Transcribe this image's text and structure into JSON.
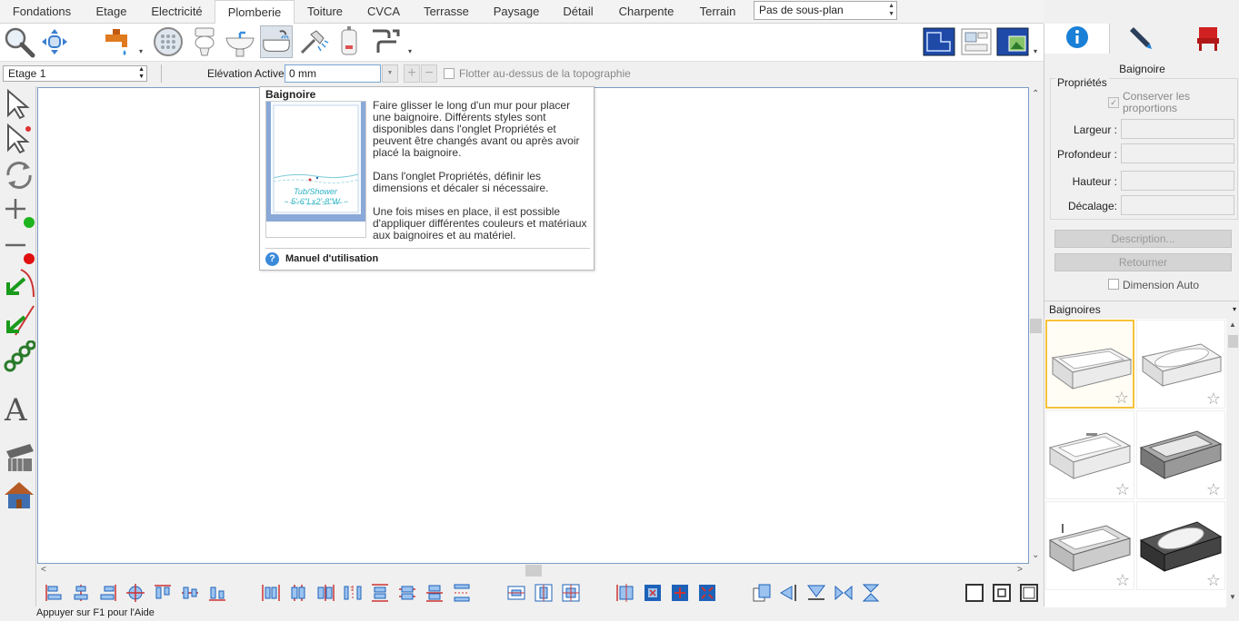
{
  "tabs": [
    "Fondations",
    "Etage",
    "Electricité",
    "Plomberie",
    "Toiture",
    "CVCA",
    "Terrasse",
    "Paysage",
    "Détail",
    "Charpente",
    "Terrain"
  ],
  "active_tab": "Plomberie",
  "subplan": "Pas de sous-plan",
  "floor": "Etage 1",
  "elevation_label": "Elévation Active:",
  "elevation_value": "0 mm",
  "float_label": "Flotter au-dessus de la topographie",
  "tooltip": {
    "title": "Baignoire",
    "image_caption_1": "Tub/Shower",
    "image_caption_2": "5'-6\"Lx2'-8\"W",
    "para1": "Faire glisser le long d'un mur pour placer une baignoire. Différents styles sont disponibles dans l'onglet Propriétés et peuvent être changés avant ou après avoir placé la baignoire.",
    "para2": "Dans l'onglet Propriétés, définir les dimensions et décaler si nécessaire.",
    "para3": "Une fois mises en place, il est possible d'appliquer différentes couleurs et matériaux aux baignoires et au matériel.",
    "manual": "Manuel d'utilisation"
  },
  "status": "Appuyer sur F1 pour l'Aide",
  "panel": {
    "title": "Baignoire",
    "props_label": "Propriétés",
    "keep_ratio": "Conserver les proportions",
    "width_label": "Largeur :",
    "depth_label": "Profondeur :",
    "height_label": "Hauteur :",
    "offset_label": "Décalage:",
    "description_button": "Description...",
    "flip_button": "Retourner",
    "auto_dim": "Dimension Auto",
    "library_title": "Baignoires"
  },
  "colors": {
    "accent": "#1a7fd6",
    "selection": "#f7c23a",
    "canvas_border": "#7a9bc4"
  }
}
